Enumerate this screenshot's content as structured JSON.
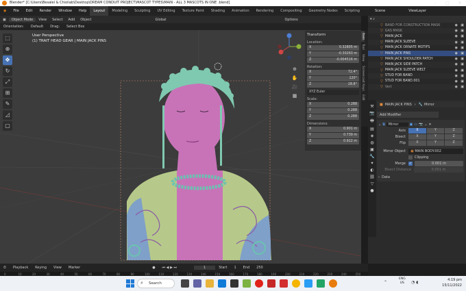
{
  "titlebar": {
    "title": "Blender* [C:\\Users\\Besalel & Chioliab\\Desktop\\DREAM CONDUIT PROJECT\\MASCOT TYPES\\MAIN - ALL 3 MASCOTS IN ONE .blend]"
  },
  "menu": {
    "items": [
      "File",
      "Edit",
      "Render",
      "Window",
      "Help"
    ]
  },
  "workspaces": [
    "Layout",
    "Modeling",
    "Sculpting",
    "UV Editing",
    "Texture Paint",
    "Shading",
    "Animation",
    "Rendering",
    "Compositing",
    "Geometry Nodes",
    "Scripting"
  ],
  "scene": {
    "scene_label": "Scene",
    "view_layer": "ViewLayer"
  },
  "viewport_header": {
    "mode": "Object Mode",
    "view": "View",
    "select": "Select",
    "add": "Add",
    "object": "Object",
    "orientation_label": "Orientation:",
    "orientation": "Default",
    "drag_label": "Drag:",
    "drag": "Select Box",
    "transform": "Global",
    "options": "Options"
  },
  "viewport": {
    "perspective": "User Perspective",
    "object_info": "(1) TRAIT HEAD GEAR | MAIN JACK PINS"
  },
  "npanel": {
    "header": "Transform",
    "location_label": "Location:",
    "location": [
      {
        "axis": "X",
        "value": "0.32805 m"
      },
      {
        "axis": "Y",
        "value": "-0.30263 m"
      },
      {
        "axis": "Z",
        "value": "-0.004516 m"
      }
    ],
    "rotation_label": "Rotation:",
    "rotation": [
      {
        "axis": "X",
        "value": "72.4°"
      },
      {
        "axis": "Y",
        "value": "120°"
      },
      {
        "axis": "Z",
        "value": "28.8°"
      }
    ],
    "rotation_mode": "XYZ Euler",
    "scale_label": "Scale:",
    "scale": [
      {
        "axis": "X",
        "value": "0.288"
      },
      {
        "axis": "Y",
        "value": "0.288"
      },
      {
        "axis": "Z",
        "value": "0.288"
      }
    ],
    "dimensions_label": "Dimensions:",
    "dimensions": [
      {
        "axis": "X",
        "value": "0.901 m"
      },
      {
        "axis": "Y",
        "value": "0.739 m"
      },
      {
        "axis": "Z",
        "value": "0.922 m"
      }
    ],
    "side_tabs": [
      "Item",
      "Tool",
      "View",
      "Screencast Keys",
      "Edit"
    ]
  },
  "outliner": {
    "rows": [
      {
        "label": "BAND FOR CONSTRUCTION MASK",
        "state": "dim"
      },
      {
        "label": "GAS MASK",
        "state": "dim"
      },
      {
        "label": "MAIN JACK",
        "state": ""
      },
      {
        "label": "MAIN JACK  SLEEVE",
        "state": ""
      },
      {
        "label": "MAIN JACK ORNATE MOTIFS",
        "state": ""
      },
      {
        "label": "MAIN JACK PINS",
        "state": "sel"
      },
      {
        "label": "MAIN JACK SHOULDER PATCH",
        "state": ""
      },
      {
        "label": "MAIN JACK SIDE PATCH",
        "state": ""
      },
      {
        "label": "MAIN JACK SLEEVE WELT",
        "state": ""
      },
      {
        "label": "STUD FOR BAND",
        "state": ""
      },
      {
        "label": "STUD FOR BAND.001",
        "state": ""
      },
      {
        "label": "Vert",
        "state": "dim"
      }
    ]
  },
  "properties": {
    "object": "MAIN JACK PINS",
    "modifier_icon": "Mirror",
    "add_modifier": "Add Modifier",
    "modifier_name": "Mirror",
    "axis_label": "Axis",
    "bisect_label": "Bisect",
    "flip_label": "Flip",
    "axes": [
      "X",
      "Y",
      "Z"
    ],
    "mirror_object_label": "Mirror Object",
    "mirror_object": "MAIN BODY.002",
    "clipping": "Clipping",
    "merge_label": "Merge",
    "merge_value": "0.001 m",
    "bisect_distance_label": "Bisect Distance",
    "bisect_distance": "0.001 m",
    "data": "Data"
  },
  "timeline": {
    "playback": "Playback",
    "keying": "Keying",
    "view": "View",
    "marker": "Marker",
    "frame": "1",
    "start_label": "Start",
    "start": "1",
    "end_label": "End",
    "end": "250"
  },
  "ruler": [
    "0",
    "10",
    "20",
    "30",
    "40",
    "50",
    "60",
    "70",
    "80",
    "90",
    "100",
    "110",
    "120",
    "130",
    "140",
    "150",
    "160",
    "170",
    "180",
    "190",
    "200",
    "210",
    "220",
    "230",
    "240",
    "250"
  ],
  "taskbar": {
    "search": "Search",
    "lang": "ENG",
    "region": "US",
    "time": "4:19 pm",
    "date": "15/11/2022"
  },
  "colors": {
    "accent": "#4772b3",
    "viewport_bg": "#3c3c3c",
    "panel": "#2b2b2b",
    "skin": "#c873b8",
    "jacket": "#b6c98a",
    "bead": "#6bc2b0"
  }
}
